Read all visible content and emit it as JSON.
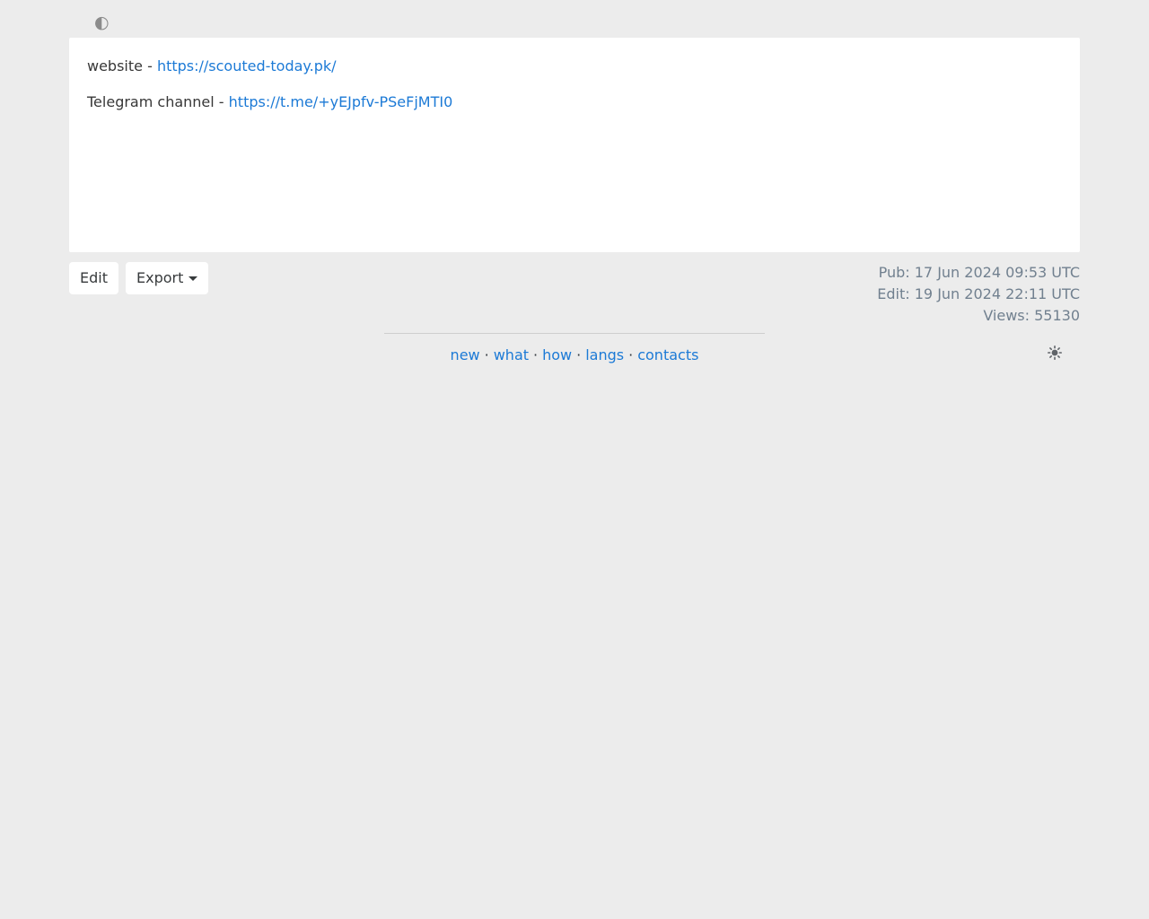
{
  "theme": {
    "page_bg": "#ececec",
    "card_bg": "#ffffff",
    "link_color": "#1c7ad6",
    "text_color": "#373737",
    "muted_color": "#71808f"
  },
  "topbar": {
    "contrast_icon_glyph": "◐"
  },
  "content": {
    "lines": [
      {
        "label": "website - ",
        "link": "https://scouted-today.pk/"
      },
      {
        "label": "Telegram channel - ",
        "link": "https://t.me/+yEJpfv-PSeFjMTI0"
      }
    ]
  },
  "toolbar": {
    "edit_label": "Edit",
    "export_label": "Export"
  },
  "meta": {
    "pub": "Pub: 17 Jun 2024 09:53 UTC",
    "edit": "Edit: 19 Jun 2024 22:11 UTC",
    "views": "Views: 55130"
  },
  "footer": {
    "links": [
      "new",
      "what",
      "how",
      "langs",
      "contacts"
    ],
    "separator": "·"
  }
}
